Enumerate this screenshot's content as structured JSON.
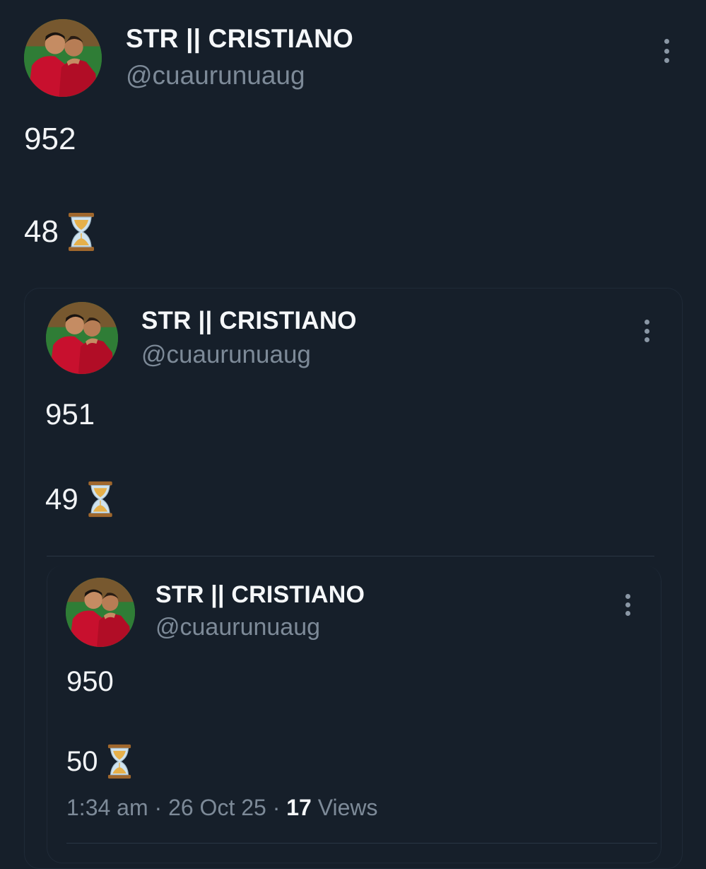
{
  "posts": [
    {
      "name": "STR || CRISTIANO",
      "handle": "@cuaurunuaug",
      "count": "952",
      "remaining": "48"
    },
    {
      "name": "STR || CRISTIANO",
      "handle": "@cuaurunuaug",
      "count": "951",
      "remaining": "49"
    },
    {
      "name": "STR || CRISTIANO",
      "handle": "@cuaurunuaug",
      "count": "950",
      "remaining": "50"
    }
  ],
  "meta": {
    "time": "1:34 am",
    "separator": "·",
    "date": "26 Oct 25",
    "views_count": "17",
    "views_label": "Views"
  },
  "icons": {
    "hourglass": "hourglass-icon",
    "more": "more-options-icon"
  },
  "colors": {
    "background": "#161f2a",
    "text": "#f2f4f6",
    "secondary": "#7d8a98",
    "jersey_red": "#c8102e"
  }
}
